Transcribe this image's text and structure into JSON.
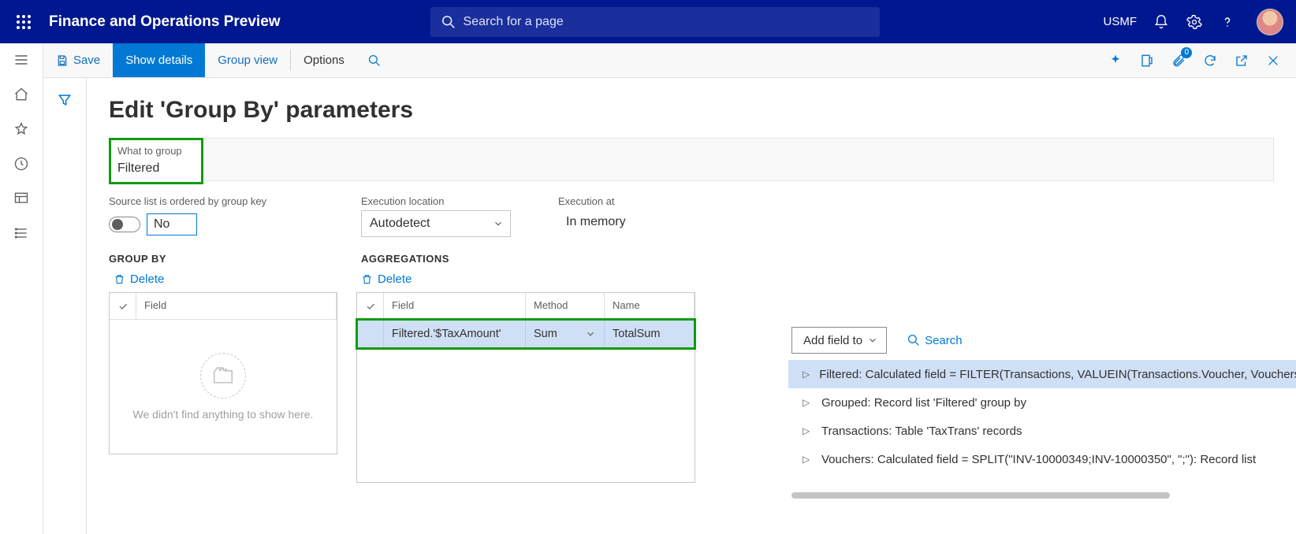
{
  "app": {
    "title": "Finance and Operations Preview"
  },
  "search": {
    "placeholder": "Search for a page"
  },
  "company": "USMF",
  "actionpane": {
    "save": "Save",
    "show_details": "Show details",
    "group_view": "Group view",
    "options": "Options",
    "attach_count": "0"
  },
  "page": {
    "title": "Edit 'Group By' parameters",
    "what_to_group_label": "What to group",
    "what_to_group_value": "Filtered",
    "source_list_label": "Source list is ordered by group key",
    "source_list_value": "No",
    "exec_loc_label": "Execution location",
    "exec_loc_value": "Autodetect",
    "exec_at_label": "Execution at",
    "exec_at_value": "In memory"
  },
  "groupby": {
    "header": "GROUP BY",
    "delete": "Delete",
    "col_field": "Field",
    "empty_msg": "We didn't find anything to show here."
  },
  "agg": {
    "header": "AGGREGATIONS",
    "delete": "Delete",
    "col_field": "Field",
    "col_method": "Method",
    "col_name": "Name",
    "rows": [
      {
        "field": "Filtered.'$TaxAmount'",
        "method": "Sum",
        "name": "TotalSum"
      }
    ]
  },
  "ds": {
    "add_label": "Add field to",
    "search_label": "Search",
    "items": [
      "Filtered: Calculated field = FILTER(Transactions, VALUEIN(Transactions.Voucher, Vouchers, Vouchers.Value))",
      "Grouped: Record list 'Filtered' group by",
      "Transactions: Table 'TaxTrans' records",
      "Vouchers: Calculated field = SPLIT(\"INV-10000349;INV-10000350\", \";\"): Record list"
    ]
  }
}
